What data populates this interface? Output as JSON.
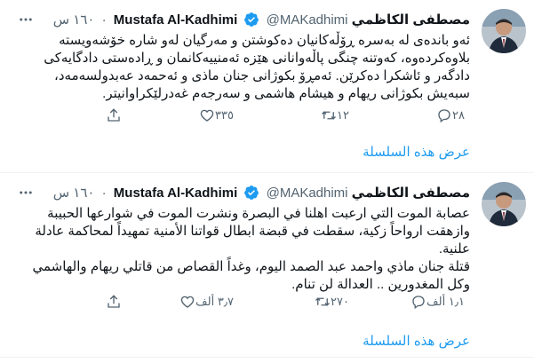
{
  "tweets": [
    {
      "author": {
        "name": "مصطفى الكاظمي Mustafa Al-Kadhimi",
        "handle": "@MAKadhimi",
        "time": "١٦٠ س"
      },
      "lines": [
        "ئەو باندەی لە بەسرە ڕۆڵەکانیان دەکوشتن و مەرگیان لەو شارە خۆشەویستە",
        "بلاوەکردەوە، کەوتنە چنگی پاڵەوانانی هێزە ئەمنییەکانمان و ڕادەستی دادگایەکی",
        "دادگەر و ئاشکرا دەکرێن. ئەمڕۆ بکوژانی جنان ماذی و ئەحمەد عەبدولسەمەد،",
        "سبەیش بکوژانی ریهام و هیشام هاشمی و سەرجەم غەدرلێکراوانیتر."
      ],
      "stats": {
        "replies": "٢٨",
        "retweets": "١٢",
        "likes": "٣٣٥"
      },
      "show_thread": "عرض هذه السلسلة"
    },
    {
      "author": {
        "name": "مصطفى الكاظمي Mustafa Al-Kadhimi",
        "handle": "@MAKadhimi",
        "time": "١٦٠ س"
      },
      "lines": [
        "عصابة الموت التي ارعبت اهلنا في البصرة ونشرت الموت في شوارعها الحبيبة",
        "وازهقت ارواحاً زكية، سقطت في قبضة ابطال قواتنا الأمنية تمهيداً لمحاكمة عادلة",
        "علنية.",
        "قتلة جنان ماذي واحمد عبد الصمد اليوم، وغداً القصاص من قاتلي ريهام والهاشمي",
        "وكل المغدورين .. العدالة لن تنام."
      ],
      "stats": {
        "replies": "١٫١ ألف",
        "retweets": "٢٧٠",
        "likes": "٣٫٧ ألف"
      },
      "show_thread": "عرض هذه السلسلة"
    }
  ],
  "icons": {
    "verified": "verified-badge-icon",
    "more": "more-horizontal-icon",
    "reply": "reply-icon",
    "retweet": "retweet-icon",
    "like": "heart-icon",
    "share": "share-icon"
  },
  "colors": {
    "accent": "#1d9bf0",
    "secondary_text": "#536471",
    "text": "#0f1419",
    "divider": "#eff3f4"
  }
}
